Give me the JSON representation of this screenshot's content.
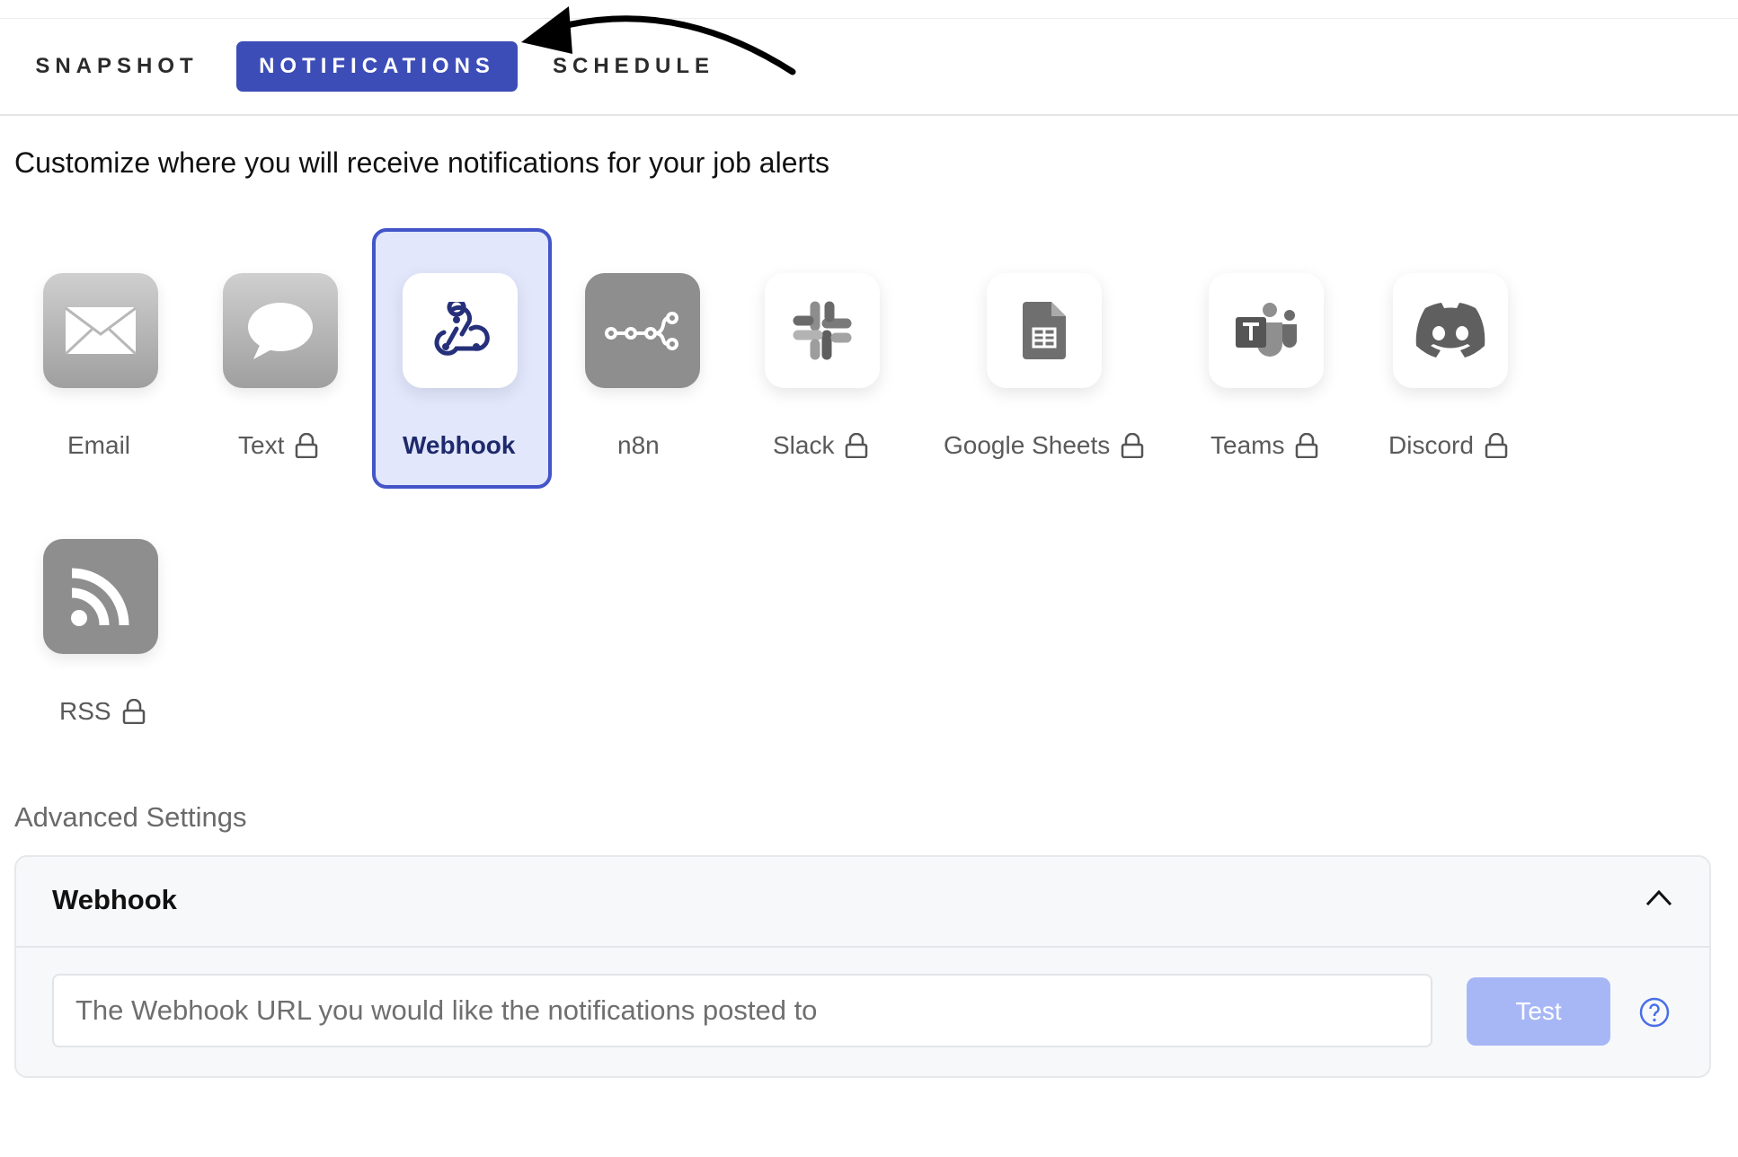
{
  "tabs": [
    {
      "label": "SNAPSHOT"
    },
    {
      "label": "NOTIFICATIONS"
    },
    {
      "label": "SCHEDULE"
    }
  ],
  "active_tab": "NOTIFICATIONS",
  "headline": "Customize where you will receive notifications for your job alerts",
  "channels": [
    {
      "label": "Email",
      "icon": "envelope-icon",
      "locked": false
    },
    {
      "label": "Text",
      "icon": "chat-bubble-icon",
      "locked": true
    },
    {
      "label": "Webhook",
      "icon": "webhook-icon",
      "locked": false,
      "selected": true
    },
    {
      "label": "n8n",
      "icon": "n8n-icon",
      "locked": false
    },
    {
      "label": "Slack",
      "icon": "slack-icon",
      "locked": true
    },
    {
      "label": "Google Sheets",
      "icon": "google-sheets-icon",
      "locked": true
    },
    {
      "label": "Teams",
      "icon": "teams-icon",
      "locked": true
    },
    {
      "label": "Discord",
      "icon": "discord-icon",
      "locked": true
    },
    {
      "label": "RSS",
      "icon": "rss-icon",
      "locked": true
    }
  ],
  "advanced": {
    "title": "Advanced Settings",
    "panel_title": "Webhook",
    "url_placeholder": "The Webhook URL you would like the notifications posted to",
    "url_value": "",
    "test_label": "Test"
  },
  "colors": {
    "accent": "#3d4db7",
    "selected_bg": "#e2e7fc",
    "test_button": "#a7b7f6"
  }
}
